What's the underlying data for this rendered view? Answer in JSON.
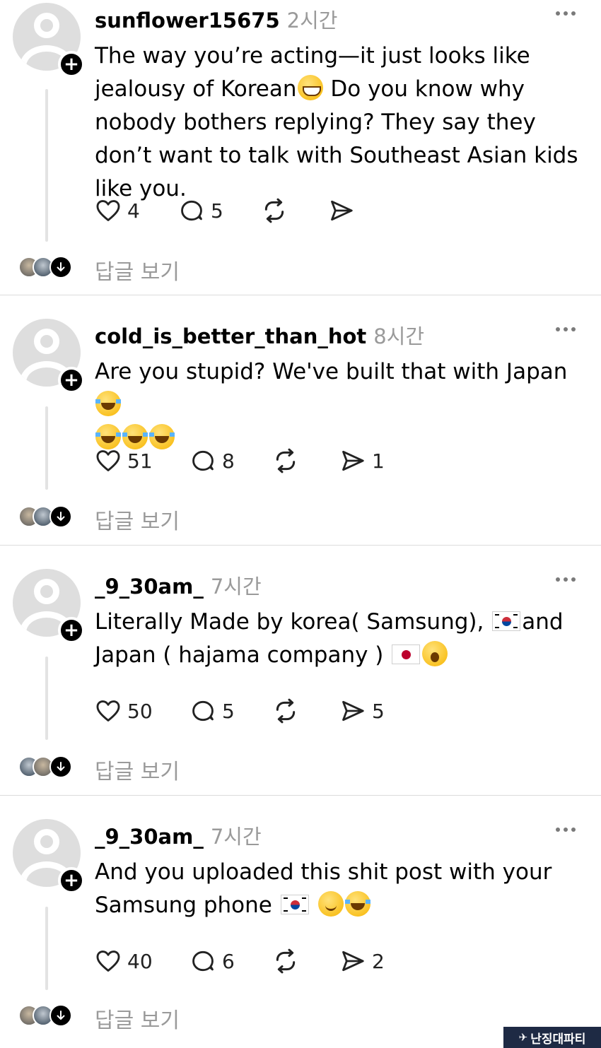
{
  "posts": [
    {
      "username": "sunflower15675",
      "time": "2시간",
      "text_parts": [
        "The way you’re acting—it just looks like jealousy of Korean",
        " Do you know why nobody bothers replying? They say they don’t want to talk with Southeast Asian kids like you."
      ],
      "likes": "4",
      "comments": "5",
      "reposts": "",
      "shares": "",
      "view_replies": "답글 보기"
    },
    {
      "username": "cold_is_better_than_hot",
      "time": "8시간",
      "text_parts": [
        "Are you stupid? We've built that with Japan "
      ],
      "likes": "51",
      "comments": "8",
      "reposts": "",
      "shares": "1",
      "view_replies": "답글 보기"
    },
    {
      "username": "_9_30am_",
      "time": "7시간",
      "text_parts": [
        "Literally Made by korea( Samsung), ",
        "and Japan ( hajama company ) "
      ],
      "likes": "50",
      "comments": "5",
      "reposts": "",
      "shares": "5",
      "view_replies": "답글 보기"
    },
    {
      "username": "_9_30am_",
      "time": "7시간",
      "text_parts": [
        "And you uploaded this shit post with your Samsung phone "
      ],
      "likes": "40",
      "comments": "6",
      "reposts": "",
      "shares": "2",
      "view_replies": "답글 보기"
    }
  ],
  "watermark": "난징대파티",
  "icons": [
    "heart-icon",
    "comment-icon",
    "repost-icon",
    "share-icon",
    "more-icon",
    "plus-icon",
    "arrow-down-icon"
  ],
  "colors": {
    "text": "#000000",
    "muted": "#9a9a9a",
    "divider": "#dcdcdc",
    "avatar_bg": "#dedede"
  }
}
